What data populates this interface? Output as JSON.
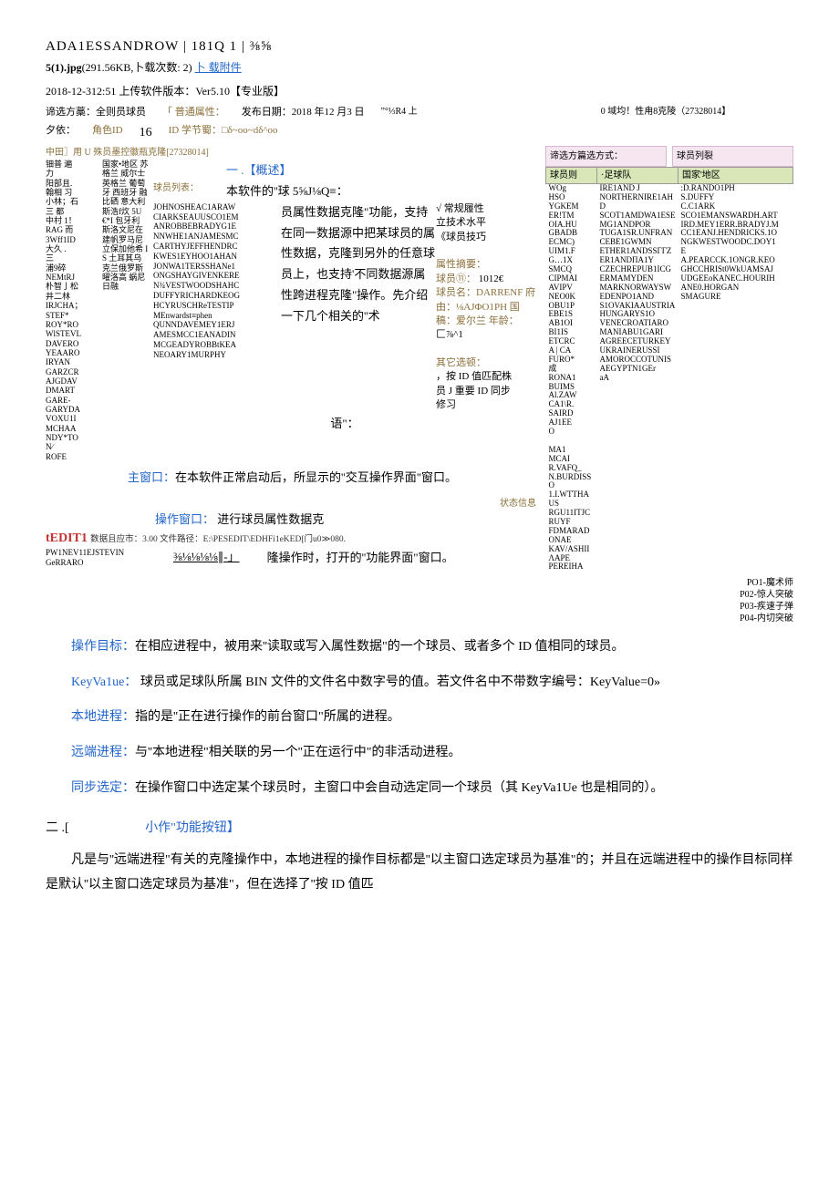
{
  "header": {
    "title": "ADA1ESSANDROW | 181Q   1 | ⅜⅝",
    "file_line_a": "5(1).jpg",
    "file_line_b": "(291.56KB,卜载次数: 2)",
    "file_link": "卜 载附件",
    "version": "2018-12-312:51 上传软件版本：Ver5.10【专业版】"
  },
  "row1": {
    "a": "谛选方藁：全则员球员",
    "b": "「 普通属性：",
    "c": "发布日期：2018 年12 月3 日",
    "d": "”°⅓R4 上"
  },
  "row_right_top": "0 域均！性甪8克陵（27328014】",
  "row2": {
    "a": "夕依：",
    "b": "角色ID",
    "c": "16",
    "d": "ID 学节蜀：□δ~oo~dδ^oo"
  },
  "concept": {
    "left_header": "中田〗用 U 殊员墨控徽瓶克隆[27328014]",
    "label": "一 .【概述】",
    "line1": "球员列表：",
    "line2": "本软件的''球 5⅝J⅛Q≡：",
    "sub1": "√ 常规履性",
    "sub2": "立技术水平",
    "sub3": "《球员技巧"
  },
  "left_noise_col1": "钿普 遍\n力\n阳部且.\n翰相 习\n小林；石\n三 都\n中村 1！\nRAG 而\n3Wff1ID\n大久 .\n三\n浦9碎\nNEMtRJ\n朴智亅松\n井二林\nIRJCHA；\nSTEF*\nROY*RO\nWlSTEVL\nDAVERO\nYEAARO\nIRYAN\nGARZCR\nAJGDAV\nDMART\nGARE-\nGARYDA\nVOXU1I\nMCHAA\nNDY*TO\nN∕\nROFE",
  "left_noise_col2": "国家•地区\n\n苏格兰\n威尔士\n英格兰\n葡萄牙\n西班牙\n融比硒\n\n意大利\n\n斯浩f炊\n5U€*I 包牙利\n斯洛文尼在\n建帆罗马尼\n立保加他希\nIS 土耳其乌\n克兰俄罗斯\n曜洛高\n\n蜗尼日融",
  "mid_noise": "JOHNOSHEAC1ARAW\nCIARKSEAUUSCO1EM\nANROBBEBRADYG1E\nNNWHE1ANJAMESMC\nCARTHYJEFFHENDRC\nKWES1EYHOO1AHAN\nJONWA1TERSSHANe1\nONGSHAYGIVENKERE\nN¾VESTWOODSHAHC\nDUFFYRICHARDKEOG\nHCYRUSCHReTESTIP\nMEnwardst≡phen\nQUNNDAVEMEY1ERJ\nAMESMCC1EANADIN\nMCGEADYROBBtKEA\nNEOARY1MURPHY",
  "intro_body": "员属性数据克隆\"功能，支持在同一数据源中把某球员的属性数据，克隆到另外的任意球员上，也支持'不同数据源属性跨进程克隆\"操作。先介绍一下几个相关的''术",
  "intro_tail": "语\"：",
  "summary_block": {
    "head": "属性摘要：",
    "l1a": "球员⑪：",
    "l1b": "1012€",
    "l2": "球员名：DARRENF 府",
    "l3": "由：⅛AJΦO1PH 国",
    "l4": "稿：爱尔兰 年龄：",
    "l5": "匚⅞^1"
  },
  "other_opts": {
    "head": "其它选顿：",
    "l1": "，按 ID 值匹配株",
    "l2": "员 J 重要 ID 同步",
    "l3": "修习"
  },
  "right_pink1": "谛选方篇选方式：",
  "right_pink2": "球员列裂",
  "table": {
    "h1": "球员则",
    "h2": "·足球队",
    "h3": "国家'地区",
    "col1": "WOg\nHSO\nYGKEM\nER!TM\nOIA.HU\nGBADB\nECMC)\nUIM1.F\nG…1X\nSMCQ\nCIPMAI\nAVIPV\nNEO0K\nOBU1P\nEBE1S\nAB1OI\nBI1IS\nETCRC\nA | CA\nFURO*\n成\nRONA1\nBUIMS\nAl.ZAW\nCA1\\R.\nSAIRD\nAJ1EE\nO\n\nMA1\nMCAI\nR.VAFQ_\nN.BURDISSO\n1.I.WTTHAUS\nRGU11ITJCRUYF\nFDMARADONAE\nKAV/ASHIIΛAPE\nPEREIHA",
    "col2": "IRE1AND                      J\nNORTHERNIRE1AHD\nSCOT1AMDWA1ESEMG1ANDPOR\nTUGA1SR.UNFRANCEBE1GWMN\nETHER1ANDSSΓΓΖER1ANDΠA1Y\nCZECHREPUB1ICGERMAMYDEN\nMARKNORWAYSWEDENPO1AND\nS1OVAKIAAUSTRIAHUNGARYS1O\nVENECROATIAROMANIABU1GARI\nAGREECETURKEYUKRAINERUSSI\nAMOROCCOTUNISAEGYPTN1GEr\naA",
    "col3": ":D.RANDO1PH\nS.DUFFY\nC.C1ARK\nSCO1EMANSWARDH.ART\nIRD.MEY1ERR.BRADYJ.M\nCC1EANJ.HENDRICKS.1O\nNGKWESTWOODC.DOY1\nE\nA.PEARCCK.1ONGR.KEO\nGHCCHRISt0WkUAMSAJ\nUDGEEoKANEC.HOURIH\nANE0.HORGAN\nSMAGURE"
  },
  "main_window": {
    "label": "主窗口：",
    "text": "在本软件正常启动后，所显示的''交互操作界面\"窗口。"
  },
  "op_window": {
    "status_label": "状态信息",
    "label": "操作窗口：",
    "text1": "进行球员属性数据克",
    "tedit": "tEDIT1",
    "tedit_status": "数据且应市：3.00 文件路径：E:\\PESEDIT\\EDHFi1eKED[门u0≫080.",
    "pw": "PW1NEV11EJSTEVIN\nGeRRARO",
    "text2a": "⅜⅛⅛⅛⅛∥-」",
    "text2b": "隆操作时，打开的''功能界面\"窗口。"
  },
  "p_list": {
    "l1": "PO1-魔术师",
    "l2": "P02-惊人突破",
    "l3": "P03-疾速子弹",
    "l4": "P04-内切突破"
  },
  "defs": {
    "op_target_label": "操作目标：",
    "op_target": "在相应进程中，被用来''读取或写入属性数据\"的一个球员、或者多个 ID 值相同的球员。",
    "keyvalue_label": "KeyVa1ue：",
    "keyvalue": " 球员或足球队所属 BIN 文件的文件名中数字号的值。若文件名中不带数字编号：KeyValue=0»",
    "local_label": "本地进程：",
    "local": "指的是''正在进行操作的前台窗口\"所属的进程。",
    "remote_label": "远端进程：",
    "remote": "与''本地进程\"相关联的另一个''正在运行中\"的非活动进程。",
    "sync_label": "同步选定：",
    "sync": "在操作窗口中选定某个球员时，主窗口中会自动选定同一个球员（其 KeyVa1Ue 也是相同的）。"
  },
  "sec2": {
    "head_a": "二 .[",
    "head_b": "小作\"功能按钮】",
    "body": "凡是与''远端进程\"有关的克隆操作中，本地进程的操作目标都是''以主窗口选定球员为基准\"的；并且在远端进程中的操作目标同样是默认''以主窗口选定球员为基准\"，但在选择了''按 ID 值匹"
  }
}
